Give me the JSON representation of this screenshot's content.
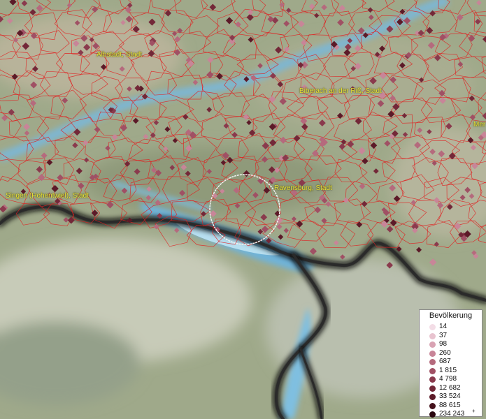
{
  "map": {
    "places": [
      {
        "name": "Albstadt, Stadt"
      },
      {
        "name": "Biberach an der Riß, Stadt"
      },
      {
        "name": "Ravensburg, Stadt"
      },
      {
        "name": "Singen (Hohentwiel), Stadt"
      },
      {
        "name": "Mer"
      }
    ],
    "legend": {
      "title": "Bevölkerung",
      "classes": [
        {
          "value": "14",
          "color": "#f3dde6"
        },
        {
          "value": "37",
          "color": "#e8c3cf"
        },
        {
          "value": "98",
          "color": "#d9a3b3"
        },
        {
          "value": "260",
          "color": "#c88598"
        },
        {
          "value": "687",
          "color": "#b56a7d"
        },
        {
          "value": "1 815",
          "color": "#a05064"
        },
        {
          "value": "4 798",
          "color": "#8a3a4d"
        },
        {
          "value": "12 682",
          "color": "#732838"
        },
        {
          "value": "33 524",
          "color": "#5c1a28"
        },
        {
          "value": "88 615",
          "color": "#44101b"
        },
        {
          "value": "234 243",
          "color": "#2a070f"
        }
      ],
      "plus_mark": "+"
    },
    "colors": {
      "terrain": "#9fa98a",
      "lake": "#6fb3d8",
      "boundary": "#e02020",
      "border": "#1a1a1a",
      "label": "#e8e23a",
      "marker": "#7a2a38"
    }
  }
}
